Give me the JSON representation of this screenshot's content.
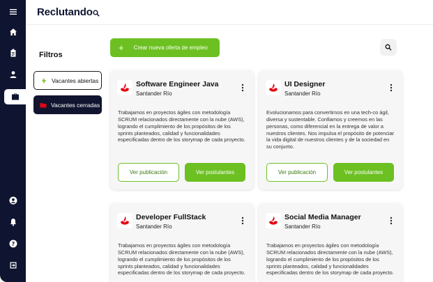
{
  "app": {
    "logo_text": "Reclutando"
  },
  "sidebar": {
    "items": [
      {
        "name": "menu-icon"
      },
      {
        "name": "home-icon"
      },
      {
        "name": "clipboard-icon"
      },
      {
        "name": "user-icon"
      },
      {
        "name": "briefcase-icon",
        "active": true
      },
      {
        "name": "profile-icon"
      },
      {
        "name": "bell-icon"
      },
      {
        "name": "help-icon"
      },
      {
        "name": "logout-icon"
      }
    ]
  },
  "filters": {
    "title": "Filtros",
    "open_label": "Vacantes abiertas",
    "closed_label": "Vacantes cerradas"
  },
  "actions": {
    "create_label": "Crear nueva oferta de empleo",
    "create_icon": "+"
  },
  "cards": [
    {
      "title": "Software Engineer Java",
      "company": "Santander Río",
      "description": "Trabajamos en proyectos ágiles con metodología SCRUM relacionados directamente con la nube (AWS), logrando el cumplimiento de los propósitos de los sprints planteados, calidad y funcionalidades especificadas dentro de los storymap de cada proyecto.",
      "view_label": "Ver publicación",
      "applicants_label": "Ver postulantes"
    },
    {
      "title": "UI Designer",
      "company": "Santander Río",
      "description": "Evolucionamos para convertirnos en una tech-co ágil, diversa y sustentable. Confiamos y creemos en las personas, como diferencial en la entrega de valor a nuestros clientes. Nos impulsa el propósito de potenciar la vida digital de nuestros clientes y de la sociedad en su conjunto.",
      "view_label": "Ver publicación",
      "applicants_label": "Ver postulantes"
    },
    {
      "title": "Developer FullStack",
      "company": "Santander Río",
      "description": "Trabajamos en proyectos ágiles con metodología SCRUM relacionados directamente con la nube (AWS), logrando el cumplimiento de los propósitos de los sprints planteados, calidad y funcionalidades especificadas dentro de los storymap de cada proyecto.",
      "view_label": "Ver publicación",
      "applicants_label": "Ver postulantes"
    },
    {
      "title": "Social Media Manager",
      "company": "Santander Río",
      "description": "Trabajamos en proyectos ágiles con metodología SCRUM relacionados directamente con la nube (AWS), logrando el cumplimiento de los propósitos de los sprints planteados, calidad y funcionalidades especificadas dentro de los storymap de cada proyecto.",
      "view_label": "Ver publicación",
      "applicants_label": "Ver postulantes"
    }
  ],
  "colors": {
    "sidebar": "#0f1530",
    "accent_green": "#6cc021",
    "brand_red": "#e30613"
  }
}
